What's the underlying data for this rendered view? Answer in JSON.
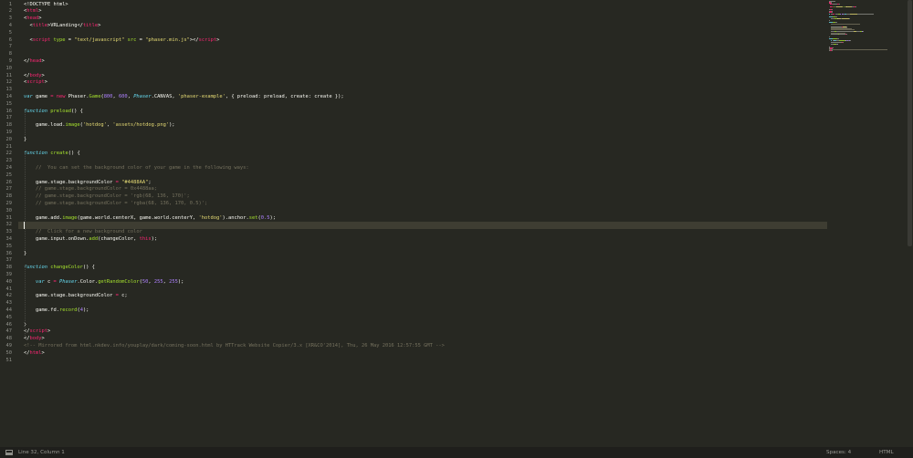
{
  "editor": {
    "lines": [
      [
        [
          "pl",
          "<!DOCTYPE html>"
        ]
      ],
      [
        [
          "pl",
          "<"
        ],
        [
          "tag",
          "html"
        ],
        [
          "pl",
          ">"
        ]
      ],
      [
        [
          "pl",
          "<"
        ],
        [
          "tag",
          "head"
        ],
        [
          "pl",
          ">"
        ]
      ],
      [
        [
          "pl",
          "  <"
        ],
        [
          "tag",
          "title"
        ],
        [
          "pl",
          ">VRLanding</"
        ],
        [
          "tag",
          "title"
        ],
        [
          "pl",
          ">"
        ]
      ],
      [
        [
          "pl",
          ""
        ]
      ],
      [
        [
          "pl",
          "  <"
        ],
        [
          "tag",
          "script"
        ],
        [
          "pl",
          " "
        ],
        [
          "at",
          "type"
        ],
        [
          "pl",
          " = "
        ],
        [
          "st",
          "\"text/javascript\""
        ],
        [
          "pl",
          " "
        ],
        [
          "at",
          "src"
        ],
        [
          "pl",
          " = "
        ],
        [
          "st",
          "\"phaser.min.js\""
        ],
        [
          "pl",
          "></"
        ],
        [
          "tag",
          "script"
        ],
        [
          "pl",
          ">"
        ]
      ],
      [
        [
          "pl",
          ""
        ]
      ],
      [
        [
          "pl",
          ""
        ]
      ],
      [
        [
          "pl",
          "</"
        ],
        [
          "tag",
          "head"
        ],
        [
          "pl",
          ">"
        ]
      ],
      [
        [
          "pl",
          ""
        ]
      ],
      [
        [
          "pl",
          "</"
        ],
        [
          "tag",
          "body"
        ],
        [
          "pl",
          ">"
        ]
      ],
      [
        [
          "pl",
          "<"
        ],
        [
          "tag",
          "script"
        ],
        [
          "pl",
          ">"
        ]
      ],
      [
        [
          "pl",
          ""
        ]
      ],
      [
        [
          "sup",
          "var"
        ],
        [
          "pl",
          " game "
        ],
        [
          "kw",
          "="
        ],
        [
          "pl",
          " "
        ],
        [
          "kw",
          "new"
        ],
        [
          "pl",
          " Phaser."
        ],
        [
          "fn",
          "Game"
        ],
        [
          "pl",
          "("
        ],
        [
          "num",
          "800"
        ],
        [
          "pl",
          ", "
        ],
        [
          "num",
          "600"
        ],
        [
          "pl",
          ", "
        ],
        [
          "sup",
          "Phaser"
        ],
        [
          "pl",
          ".CANVAS, "
        ],
        [
          "st",
          "'phaser-example'"
        ],
        [
          "pl",
          ", { preload: preload, create: create });"
        ]
      ],
      [
        [
          "pl",
          ""
        ]
      ],
      [
        [
          "sup",
          "function"
        ],
        [
          "pl",
          " "
        ],
        [
          "fn",
          "preload"
        ],
        [
          "pl",
          "() {"
        ]
      ],
      [
        [
          "pl",
          ""
        ]
      ],
      [
        [
          "pl",
          "    game.load."
        ],
        [
          "fn",
          "image"
        ],
        [
          "pl",
          "("
        ],
        [
          "st",
          "'hotdog'"
        ],
        [
          "pl",
          ", "
        ],
        [
          "st",
          "'assets/hotdog.png'"
        ],
        [
          "pl",
          ");"
        ]
      ],
      [
        [
          "pl",
          ""
        ]
      ],
      [
        [
          "pl",
          "}"
        ]
      ],
      [
        [
          "pl",
          ""
        ]
      ],
      [
        [
          "sup",
          "function"
        ],
        [
          "pl",
          " "
        ],
        [
          "fn",
          "create"
        ],
        [
          "pl",
          "() {"
        ]
      ],
      [
        [
          "pl",
          ""
        ]
      ],
      [
        [
          "cm",
          "    //  You can set the background color of your game in the following ways:"
        ]
      ],
      [
        [
          "pl",
          ""
        ]
      ],
      [
        [
          "pl",
          "    game.stage.backgroundColor "
        ],
        [
          "kw",
          "="
        ],
        [
          "pl",
          " "
        ],
        [
          "st",
          "\"#4488AA\""
        ],
        [
          "pl",
          ";"
        ]
      ],
      [
        [
          "cm",
          "    // game.stage.backgroundColor = 0x4488aa;"
        ]
      ],
      [
        [
          "cm",
          "    // game.stage.backgroundColor = 'rgb(68, 136, 170)';"
        ]
      ],
      [
        [
          "cm",
          "    // game.stage.backgroundColor = 'rgba(68, 136, 170, 0.5)';"
        ]
      ],
      [
        [
          "pl",
          ""
        ]
      ],
      [
        [
          "pl",
          "    game.add."
        ],
        [
          "fn",
          "image"
        ],
        [
          "pl",
          "(game.world.centerX, game.world.centerY, "
        ],
        [
          "st",
          "'hotdog'"
        ],
        [
          "pl",
          ").anchor."
        ],
        [
          "fn",
          "set"
        ],
        [
          "pl",
          "("
        ],
        [
          "num",
          "0.5"
        ],
        [
          "pl",
          ");"
        ]
      ],
      [
        [
          "pl",
          ""
        ]
      ],
      [
        [
          "cm",
          "    //  Click for a new background color"
        ]
      ],
      [
        [
          "pl",
          "    game.input.onDown."
        ],
        [
          "fn",
          "add"
        ],
        [
          "pl",
          "(changeColor, "
        ],
        [
          "kw",
          "this"
        ],
        [
          "pl",
          ");"
        ]
      ],
      [
        [
          "pl",
          ""
        ]
      ],
      [
        [
          "pl",
          "}"
        ]
      ],
      [
        [
          "pl",
          ""
        ]
      ],
      [
        [
          "sup",
          "function"
        ],
        [
          "pl",
          " "
        ],
        [
          "fn",
          "changeColor"
        ],
        [
          "pl",
          "() {"
        ]
      ],
      [
        [
          "pl",
          ""
        ]
      ],
      [
        [
          "pl",
          "    "
        ],
        [
          "sup",
          "var"
        ],
        [
          "pl",
          " c "
        ],
        [
          "kw",
          "="
        ],
        [
          "pl",
          " "
        ],
        [
          "sup",
          "Phaser"
        ],
        [
          "pl",
          ".Color."
        ],
        [
          "fn",
          "getRandomColor"
        ],
        [
          "pl",
          "("
        ],
        [
          "num",
          "50"
        ],
        [
          "pl",
          ", "
        ],
        [
          "num",
          "255"
        ],
        [
          "pl",
          ", "
        ],
        [
          "num",
          "255"
        ],
        [
          "pl",
          ");"
        ]
      ],
      [
        [
          "pl",
          ""
        ]
      ],
      [
        [
          "pl",
          "    game.stage.backgroundColor "
        ],
        [
          "kw",
          "="
        ],
        [
          "pl",
          " c;"
        ]
      ],
      [
        [
          "pl",
          ""
        ]
      ],
      [
        [
          "pl",
          "    game.fd."
        ],
        [
          "fn",
          "record"
        ],
        [
          "pl",
          "("
        ],
        [
          "num",
          "4"
        ],
        [
          "pl",
          ");"
        ]
      ],
      [
        [
          "pl",
          ""
        ]
      ],
      [
        [
          "pl",
          "}"
        ]
      ],
      [
        [
          "pl",
          "</"
        ],
        [
          "tag",
          "script"
        ],
        [
          "pl",
          ">"
        ]
      ],
      [
        [
          "pl",
          "</"
        ],
        [
          "tag",
          "body"
        ],
        [
          "pl",
          ">"
        ]
      ],
      [
        [
          "cm",
          "<!-- Mirrored from html.nkdev.info/youplay/dark/coming-soon.html by HTTrack Website Copier/3.x [XR&CO'2014], Thu, 26 May 2016 12:57:55 GMT -->"
        ]
      ],
      [
        [
          "pl",
          "</"
        ],
        [
          "tag",
          "html"
        ],
        [
          "pl",
          ">"
        ]
      ],
      [
        [
          "pl",
          ""
        ]
      ]
    ],
    "current_line": 32
  },
  "status_bar": {
    "position": "Line 32, Column 1",
    "indentation": "Spaces: 4",
    "syntax": "HTML"
  },
  "colors": {
    "background": "#272822",
    "keyword": "#f92672",
    "string": "#e6db74",
    "number": "#ae81ff",
    "function": "#a6e22e",
    "storage": "#66d9ef",
    "comment": "#75715e",
    "status_bar": "#1f1f1c"
  }
}
